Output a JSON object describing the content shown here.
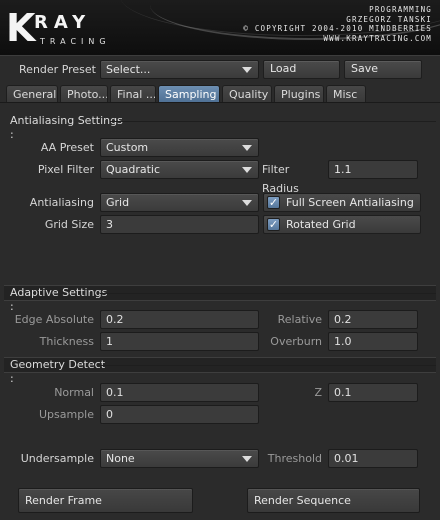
{
  "header": {
    "logo_letter": "K",
    "logo_word": "RAY",
    "logo_sub": "TRACING",
    "credits": [
      "PROGRAMMING",
      "GRZEGORZ TANSKI",
      "© COPYRIGHT 2004-2010 MINDBERRIES",
      "WWW.KRAYTRACING.COM"
    ]
  },
  "toolbar": {
    "render_preset_label": "Render Preset",
    "render_preset_value": "Select...",
    "load_label": "Load",
    "save_label": "Save"
  },
  "tabs": [
    {
      "label": "General",
      "active": false
    },
    {
      "label": "Photo...",
      "active": false
    },
    {
      "label": "Final ...",
      "active": false
    },
    {
      "label": "Sampling",
      "active": true
    },
    {
      "label": "Quality",
      "active": false
    },
    {
      "label": "Plugins",
      "active": false
    },
    {
      "label": "Misc",
      "active": false
    }
  ],
  "antialiasing": {
    "section_title": "Antialiasing Settings :",
    "aa_preset_label": "AA Preset",
    "aa_preset_value": "Custom",
    "pixel_filter_label": "Pixel Filter",
    "pixel_filter_value": "Quadratic",
    "filter_radius_label": "Filter Radius",
    "filter_radius_value": "1.1",
    "antialiasing_label": "Antialiasing",
    "antialiasing_value": "Grid",
    "fullscreen_aa_label": "Full Screen Antialiasing",
    "fullscreen_aa_checked": true,
    "grid_size_label": "Grid Size",
    "grid_size_value": "3",
    "rotated_grid_label": "Rotated Grid",
    "rotated_grid_checked": true
  },
  "adaptive": {
    "section_title": "Adaptive Settings :",
    "edge_absolute_label": "Edge Absolute",
    "edge_absolute_value": "0.2",
    "relative_label": "Relative",
    "relative_value": "0.2",
    "thickness_label": "Thickness",
    "thickness_value": "1",
    "overburn_label": "Overburn",
    "overburn_value": "1.0"
  },
  "geometry": {
    "section_title": "Geometry Detect :",
    "normal_label": "Normal",
    "normal_value": "0.1",
    "z_label": "Z",
    "z_value": "0.1",
    "upsample_label": "Upsample",
    "upsample_value": "0"
  },
  "undersample": {
    "undersample_label": "Undersample",
    "undersample_value": "None",
    "threshold_label": "Threshold",
    "threshold_value": "0.01"
  },
  "footer": {
    "render_frame_label": "Render Frame",
    "render_sequence_label": "Render Sequence"
  },
  "colors": {
    "background": "#2b2b2b",
    "active_tab": "#5b7ca0",
    "checkbox": "#6b8bb0"
  }
}
